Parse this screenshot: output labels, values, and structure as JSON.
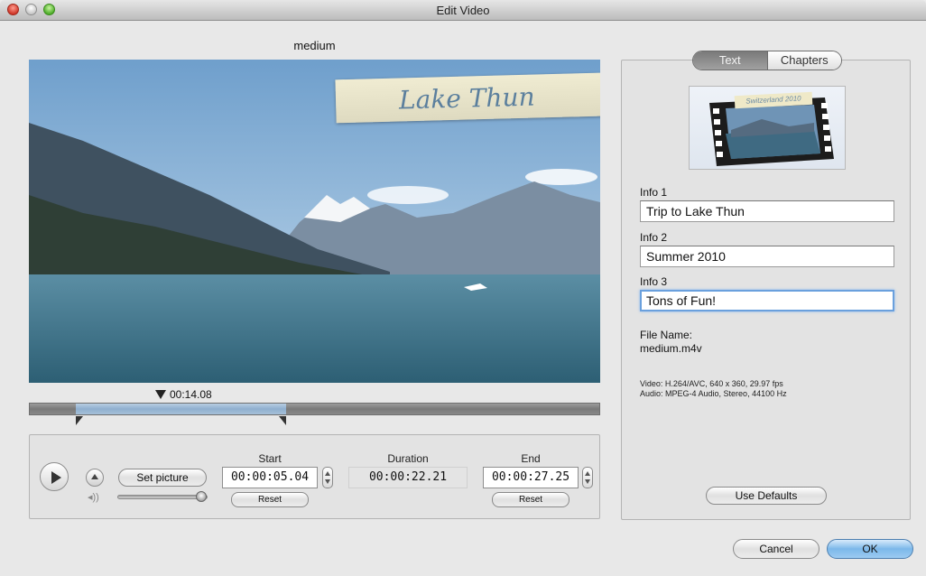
{
  "window": {
    "title": "Edit Video"
  },
  "video": {
    "name": "medium",
    "overlay_title": "Lake Thun"
  },
  "timeline": {
    "playhead_time": "00:14.08"
  },
  "controls": {
    "set_picture_label": "Set picture",
    "start": {
      "label": "Start",
      "value": "00:00:05.04",
      "reset_label": "Reset"
    },
    "duration": {
      "label": "Duration",
      "value": "00:00:22.21"
    },
    "end": {
      "label": "End",
      "value": "00:00:27.25",
      "reset_label": "Reset"
    }
  },
  "side": {
    "tabs": [
      {
        "label": "Text",
        "selected": true
      },
      {
        "label": "Chapters",
        "selected": false
      }
    ],
    "thumbnail_caption": "Switzerland 2010",
    "info1": {
      "label": "Info 1",
      "value": "Trip to Lake Thun"
    },
    "info2": {
      "label": "Info 2",
      "value": "Summer 2010"
    },
    "info3": {
      "label": "Info 3",
      "value": "Tons of Fun!"
    },
    "file_name_label": "File Name:",
    "file_name": "medium.m4v",
    "video_info": "Video: H.264/AVC, 640 x 360, 29.97 fps",
    "audio_info": "Audio: MPEG-4 Audio, Stereo, 44100 Hz",
    "use_defaults_label": "Use Defaults"
  },
  "footer": {
    "cancel_label": "Cancel",
    "ok_label": "OK"
  },
  "colors": {
    "accent": "#7cb8ea",
    "focus_ring": "#6aa0dd",
    "selection": "#8fb0cf"
  },
  "icons": [
    "play-icon",
    "eject-icon",
    "volume-icon",
    "playhead-icon"
  ]
}
